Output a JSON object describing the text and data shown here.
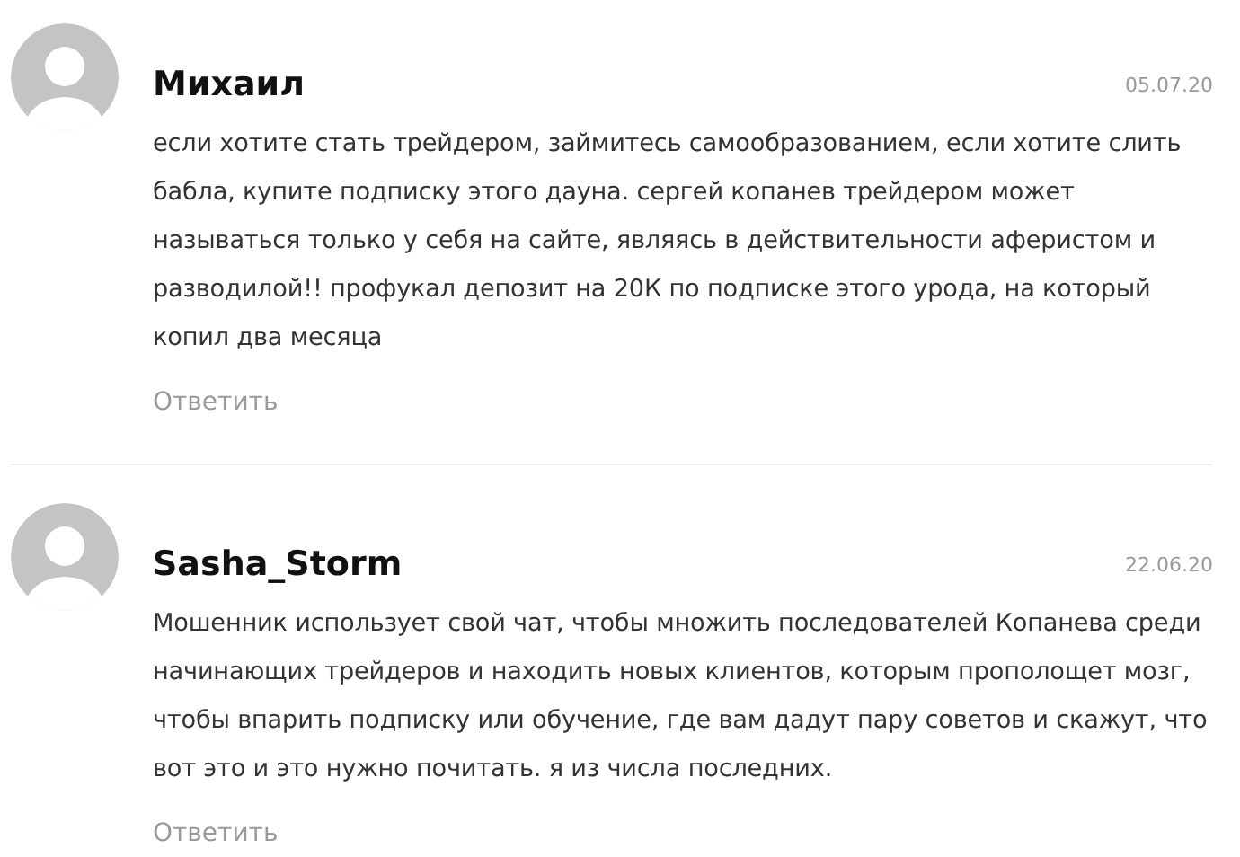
{
  "comments": [
    {
      "author": "Михаил",
      "date": "05.07.20",
      "text": "если хотите стать трейдером, займитесь самообразованием, если хотите слить бабла, купите подписку этого дауна. сергей копанев трейдером может называться только у себя на сайте, являясь в действительности аферистом и разводилой!! профукал депозит на 20К по подписке этого урода, на который копил два месяца",
      "reply": "Ответить"
    },
    {
      "author": "Sasha_Storm",
      "date": "22.06.20",
      "text": "Мошенник использует свой чат, чтобы множить последователей Копанева среди начинающих трейдеров и находить новых клиентов, которым прополощет мозг, чтобы впарить подписку или обучение, где вам дадут пару советов и скажут, что вот это и это нужно почитать. я из числа последних.",
      "reply": "Ответить"
    }
  ]
}
